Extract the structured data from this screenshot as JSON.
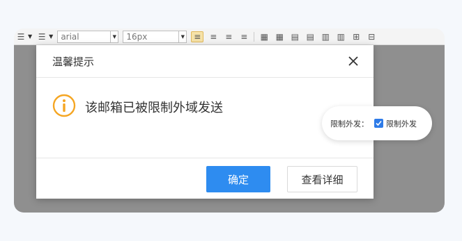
{
  "toolbar": {
    "font_family": "arial",
    "font_size": "16px"
  },
  "dialog": {
    "title": "温馨提示",
    "message": "该邮箱已被限制外域发送",
    "confirm_label": "确定",
    "details_label": "查看详细"
  },
  "callout": {
    "label": "限制外发：",
    "checkbox_label": "限制外发",
    "checked": true
  },
  "colors": {
    "primary": "#2e8cf0",
    "info_icon": "#f5a623",
    "overlay": "#8f8f8f"
  }
}
